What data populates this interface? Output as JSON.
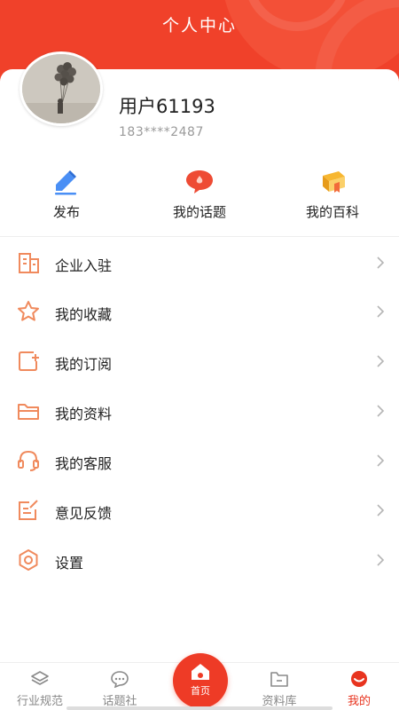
{
  "header": {
    "title": "个人中心"
  },
  "profile": {
    "name": "用户61193",
    "phone": "183****2487"
  },
  "quick_actions": [
    {
      "label": "发布",
      "icon": "pen-icon"
    },
    {
      "label": "我的话题",
      "icon": "chat-bubble-icon"
    },
    {
      "label": "我的百科",
      "icon": "book-icon"
    }
  ],
  "menu": [
    {
      "label": "企业入驻",
      "icon": "building-icon"
    },
    {
      "label": "我的收藏",
      "icon": "star-icon"
    },
    {
      "label": "我的订阅",
      "icon": "subscribe-icon"
    },
    {
      "label": "我的资料",
      "icon": "folder-icon"
    },
    {
      "label": "我的客服",
      "icon": "headset-icon"
    },
    {
      "label": "意见反馈",
      "icon": "feedback-icon"
    },
    {
      "label": "设置",
      "icon": "gear-icon"
    }
  ],
  "tabbar": {
    "items": [
      {
        "label": "行业规范",
        "icon": "layers-icon"
      },
      {
        "label": "话题社",
        "icon": "chat-icon"
      },
      {
        "label": "首页",
        "icon": "home-icon"
      },
      {
        "label": "资料库",
        "icon": "folder-icon"
      },
      {
        "label": "我的",
        "icon": "profile-icon"
      }
    ],
    "active": "我的"
  },
  "colors": {
    "accent": "#f0412a",
    "icon_orange": "#f08a5d",
    "text": "#222222",
    "muted": "#9a9a9a"
  }
}
